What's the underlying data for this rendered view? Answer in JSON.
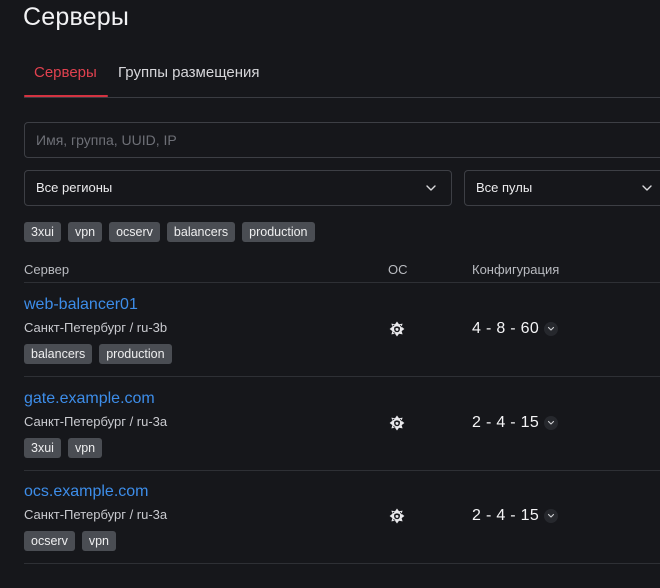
{
  "page": {
    "title": "Серверы"
  },
  "tabs": [
    {
      "label": "Серверы",
      "active": true
    },
    {
      "label": "Группы размещения",
      "active": false
    }
  ],
  "search": {
    "placeholder": "Имя, группа, UUID, IP",
    "value": ""
  },
  "filters": {
    "region": {
      "selected": "Все регионы",
      "icon": "chevron-down-icon"
    },
    "pool": {
      "selected": "Все пулы",
      "icon": "chevron-down-icon"
    },
    "tags": [
      "3xui",
      "vpn",
      "ocserv",
      "balancers",
      "production"
    ]
  },
  "table": {
    "columns": {
      "server": "Сервер",
      "os": "ОС",
      "config": "Конфигурация"
    },
    "rows": [
      {
        "name": "web-balancer01",
        "location": "Санкт-Петербург / ru-3b",
        "tags": [
          "balancers",
          "production"
        ],
        "os_icon": "os-logo-icon",
        "config": "4 - 8 - 60"
      },
      {
        "name": "gate.example.com",
        "location": "Санкт-Петербург / ru-3a",
        "tags": [
          "3xui",
          "vpn"
        ],
        "os_icon": "os-logo-icon",
        "config": "2 - 4 - 15"
      },
      {
        "name": "ocs.example.com",
        "location": "Санкт-Петербург / ru-3a",
        "tags": [
          "ocserv",
          "vpn"
        ],
        "os_icon": "os-logo-icon",
        "config": "2 - 4 - 15"
      }
    ]
  },
  "colors": {
    "background": "#16171b",
    "accent": "#d43341",
    "link": "#3d8de9",
    "tag_bg": "#4a4d53"
  }
}
